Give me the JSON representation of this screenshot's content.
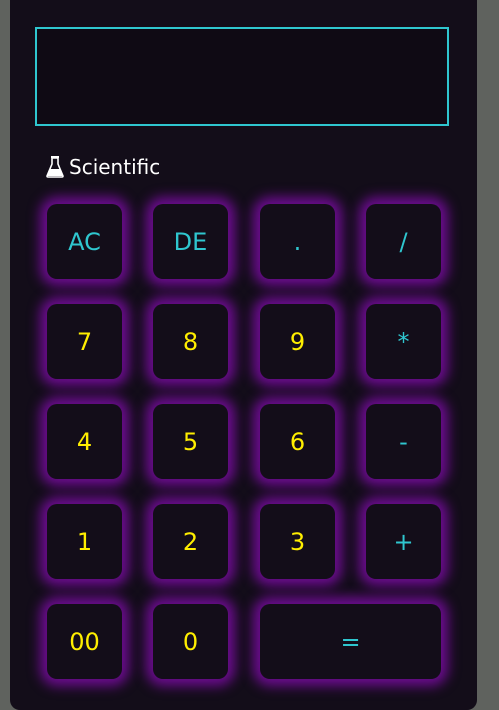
{
  "display": {
    "value": ""
  },
  "mode": {
    "label": "Scientific",
    "icon": "flask-icon"
  },
  "colors": {
    "background": "#130d19",
    "outer": "#5f625e",
    "accent_cyan": "#2fc6cf",
    "digit_yellow": "#ffee00",
    "glow_purple": "#6c0c8f"
  },
  "keys": {
    "ac": "AC",
    "de": "DE",
    "dot": ".",
    "divide": "/",
    "seven": "7",
    "eight": "8",
    "nine": "9",
    "multiply": "*",
    "four": "4",
    "five": "5",
    "six": "6",
    "minus": "-",
    "one": "1",
    "two": "2",
    "three": "3",
    "plus": "+",
    "double_zero": "00",
    "zero": "0",
    "equals": "="
  }
}
